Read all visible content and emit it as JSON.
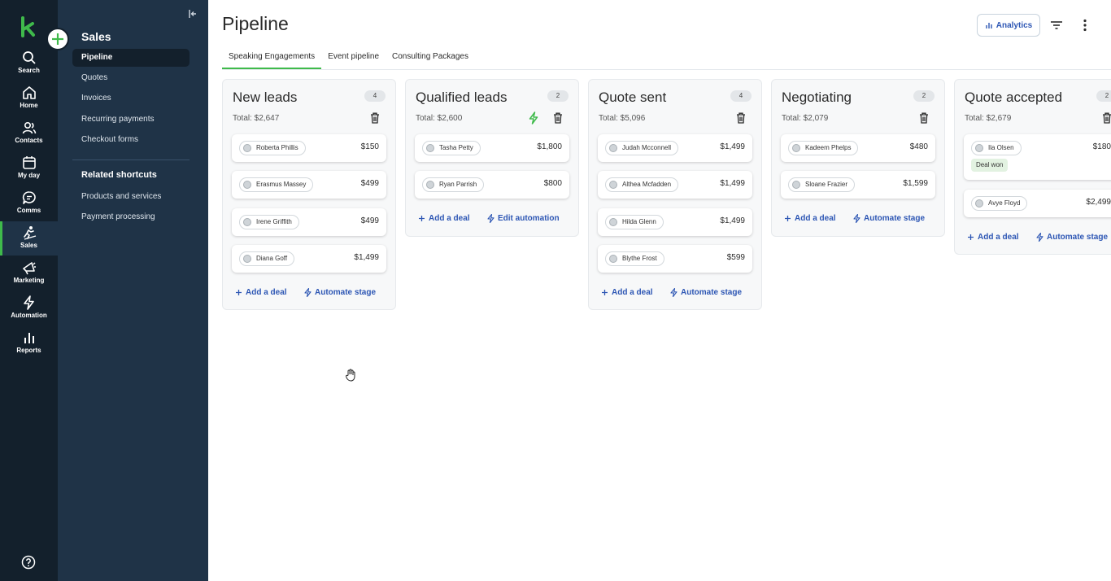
{
  "rail": {
    "items": [
      {
        "label": "Search",
        "icon": "search-icon"
      },
      {
        "label": "Home",
        "icon": "home-icon"
      },
      {
        "label": "Contacts",
        "icon": "contacts-icon"
      },
      {
        "label": "My day",
        "icon": "calendar-icon"
      },
      {
        "label": "Comms",
        "icon": "chat-icon"
      },
      {
        "label": "Sales",
        "icon": "sales-icon"
      },
      {
        "label": "Marketing",
        "icon": "megaphone-icon"
      },
      {
        "label": "Automation",
        "icon": "bolt-icon"
      },
      {
        "label": "Reports",
        "icon": "bar-chart-icon"
      }
    ]
  },
  "subnav": {
    "title": "Sales",
    "items": [
      "Pipeline",
      "Quotes",
      "Invoices",
      "Recurring payments",
      "Checkout forms"
    ],
    "section_title": "Related shortcuts",
    "shortcuts": [
      "Products and services",
      "Payment processing"
    ]
  },
  "header": {
    "title": "Pipeline",
    "analytics_label": "Analytics"
  },
  "tabs": [
    "Speaking Engagements",
    "Event pipeline",
    "Consulting Packages"
  ],
  "colors": {
    "accent_green": "#3fba4b",
    "link_blue": "#2d56b4",
    "rail_bg": "#13202c",
    "subnav_bg": "#1f3347"
  },
  "stages": [
    {
      "title": "New leads",
      "count": "4",
      "total": "Total: $2,647",
      "deals": [
        {
          "name": "Roberta Phillis",
          "value": "$150"
        },
        {
          "name": "Erasmus Massey",
          "value": "$499"
        },
        {
          "name": "Irene Griffith",
          "value": "$499"
        },
        {
          "name": "Diana Goff",
          "value": "$1,499"
        }
      ],
      "add_label": "Add a deal",
      "automation_label": "Automate stage"
    },
    {
      "title": "Qualified leads",
      "count": "2",
      "total": "Total: $2,600",
      "deals": [
        {
          "name": "Tasha Petty",
          "value": "$1,800"
        },
        {
          "name": "Ryan Parrish",
          "value": "$800"
        }
      ],
      "add_label": "Add a deal",
      "automation_label": "Edit automation"
    },
    {
      "title": "Quote sent",
      "count": "4",
      "total": "Total: $5,096",
      "deals": [
        {
          "name": "Judah Mcconnell",
          "value": "$1,499"
        },
        {
          "name": "Althea Mcfadden",
          "value": "$1,499"
        },
        {
          "name": "Hilda Glenn",
          "value": "$1,499"
        },
        {
          "name": "Blythe Frost",
          "value": "$599"
        }
      ],
      "add_label": "Add a deal",
      "automation_label": "Automate stage"
    },
    {
      "title": "Negotiating",
      "count": "2",
      "total": "Total: $2,079",
      "deals": [
        {
          "name": "Kadeem Phelps",
          "value": "$480"
        },
        {
          "name": "Sloane Frazier",
          "value": "$1,599"
        }
      ],
      "add_label": "Add a deal",
      "automation_label": "Automate stage"
    },
    {
      "title": "Quote accepted",
      "count": "2",
      "total": "Total: $2,679",
      "deals": [
        {
          "name": "Ila Olsen",
          "value": "$180",
          "badge": "Deal won"
        },
        {
          "name": "Avye Floyd",
          "value": "$2,499"
        }
      ],
      "add_label": "Add a deal",
      "automation_label": "Automate stage"
    }
  ]
}
